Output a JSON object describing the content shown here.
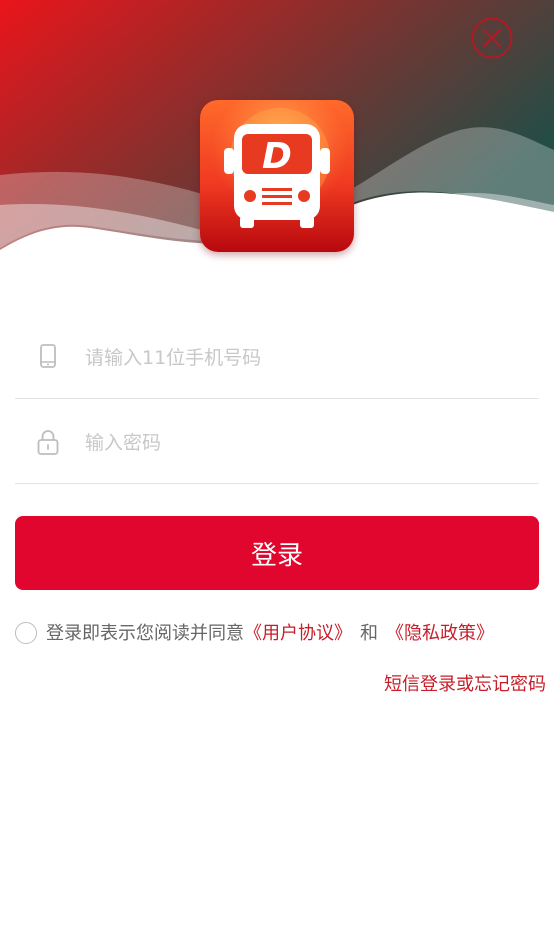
{
  "login": {
    "phone_placeholder": "请输入11位手机号码",
    "password_placeholder": "输入密码",
    "button_label": "登录"
  },
  "agreement": {
    "prefix": "登录即表示您阅读并同意",
    "user_agreement": "《用户协议》",
    "and": "和",
    "privacy_policy": "《隐私政策》"
  },
  "sms_or_forgot": "短信登录或忘记密码",
  "colors": {
    "primary": "#e1062d",
    "link": "#c81e2a",
    "header_start": "#e8161c",
    "header_end": "#2a4a44"
  },
  "icons": {
    "close": "close-icon",
    "logo": "bus-logo-icon",
    "phone": "phone-icon",
    "lock": "lock-icon"
  }
}
